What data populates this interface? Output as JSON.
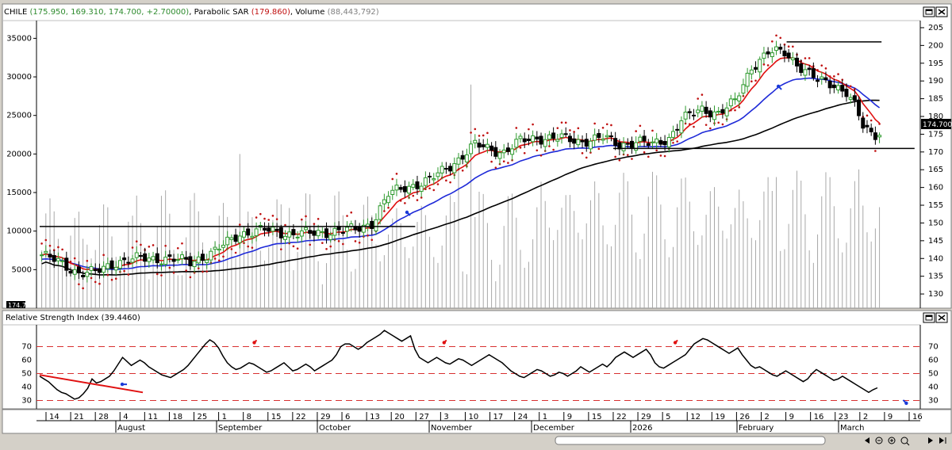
{
  "price_panel": {
    "symbol": "CHILE",
    "symbol_values": "(175.950, 169.310, 174.700, +2.70000)",
    "sar_label": "Parabolic SAR",
    "sar_value": "(179.860)",
    "volume_label": "Volume",
    "volume_value": "(88,443,792)",
    "last_price_tag": "174.7000",
    "left_stub": "174.7"
  },
  "rsi_panel": {
    "title": "Relative Strength Index (39.4460)"
  },
  "x_axis": {
    "days": [
      "14",
      "21",
      "28",
      "4",
      "11",
      "18",
      "25",
      "1",
      "8",
      "15",
      "22",
      "29",
      "6",
      "13",
      "20",
      "27",
      "3",
      "10",
      "17",
      "24",
      "1",
      "9",
      "15",
      "22",
      "29",
      "5",
      "12",
      "19",
      "26",
      "2",
      "9",
      "16",
      "23",
      "2",
      "9",
      "16"
    ],
    "months": [
      "August",
      "September",
      "October",
      "November",
      "December",
      "2026",
      "February",
      "March"
    ]
  },
  "chart_data": [
    {
      "type": "candlestick",
      "title": "CHILE",
      "price_axis": {
        "ticks": [
          130,
          135,
          140,
          145,
          150,
          155,
          160,
          165,
          170,
          175,
          180,
          185,
          190,
          195,
          200,
          205
        ],
        "ylim": [
          126,
          207
        ]
      },
      "volume_axis": {
        "ticks": [
          5000,
          10000,
          15000,
          20000,
          25000,
          30000,
          35000
        ]
      },
      "summary": {
        "open": 175.95,
        "low": 169.31,
        "close": 174.7,
        "change": 2.7,
        "parabolic_sar": 179.86,
        "volume": 88443792
      },
      "colors": {
        "up": "#2e9a2e",
        "down": "#000000",
        "ma_fast": "#e01010",
        "ma_mid": "#1e2ad8",
        "ma_slow": "#000000",
        "sar": "#c01010"
      },
      "close_anchors": [
        [
          0,
          141
        ],
        [
          4,
          139
        ],
        [
          9,
          136
        ],
        [
          13,
          136
        ],
        [
          18,
          139
        ],
        [
          24,
          140
        ],
        [
          30,
          140
        ],
        [
          36,
          139
        ],
        [
          42,
          142
        ],
        [
          48,
          147
        ],
        [
          54,
          148
        ],
        [
          60,
          147
        ],
        [
          66,
          147
        ],
        [
          72,
          148
        ],
        [
          76,
          148
        ],
        [
          80,
          150
        ],
        [
          84,
          158
        ],
        [
          88,
          160
        ],
        [
          94,
          162
        ],
        [
          100,
          167
        ],
        [
          105,
          172
        ],
        [
          108,
          171
        ],
        [
          112,
          170
        ],
        [
          116,
          173
        ],
        [
          120,
          174
        ],
        [
          125,
          174
        ],
        [
          130,
          173
        ],
        [
          136,
          174
        ],
        [
          140,
          172
        ],
        [
          144,
          173
        ],
        [
          148,
          172
        ],
        [
          152,
          174
        ],
        [
          155,
          179
        ],
        [
          160,
          182
        ],
        [
          164,
          181
        ],
        [
          168,
          184
        ],
        [
          172,
          194
        ],
        [
          176,
          198
        ],
        [
          180,
          198
        ],
        [
          184,
          194
        ],
        [
          188,
          190
        ],
        [
          192,
          189
        ],
        [
          195,
          187
        ],
        [
          197,
          183
        ],
        [
          199,
          177
        ],
        [
          201,
          175
        ],
        [
          203,
          174.7
        ]
      ],
      "trendlines": [
        {
          "from": [
            0,
            149
          ],
          "to": [
            91,
            149
          ]
        },
        {
          "from": [
            181,
            201
          ],
          "to": [
            204,
            201
          ]
        },
        {
          "from": [
            139,
            171
          ],
          "to": [
            212,
            171
          ]
        }
      ]
    },
    {
      "type": "line",
      "title": "Relative Strength Index (39.4460)",
      "y_ticks": [
        30,
        40,
        50,
        60,
        70
      ],
      "ylim": [
        25,
        85
      ],
      "reference_lines": [
        30,
        50,
        70
      ],
      "last_value": 39.446,
      "series": [
        {
          "values": [
            48,
            46,
            44,
            41,
            38,
            36,
            35,
            33,
            31,
            32,
            35,
            39,
            46,
            43,
            44,
            46,
            48,
            52,
            57,
            62,
            59,
            56,
            58,
            60,
            58,
            55,
            53,
            51,
            49,
            48,
            47,
            49,
            51,
            53,
            56,
            60,
            64,
            68,
            72,
            75,
            73,
            69,
            63,
            58,
            55,
            53,
            54,
            56,
            58,
            57,
            55,
            53,
            51,
            52,
            54,
            56,
            58,
            55,
            52,
            53,
            55,
            57,
            55,
            52,
            54,
            56,
            58,
            60,
            64,
            70,
            72,
            72,
            70,
            68,
            70,
            73,
            75,
            77,
            79,
            82,
            80,
            78,
            76,
            74,
            76,
            78,
            68,
            62,
            60,
            58,
            60,
            62,
            60,
            58,
            57,
            59,
            61,
            60,
            58,
            56,
            58,
            60,
            62,
            64,
            62,
            60,
            58,
            55,
            52,
            50,
            48,
            47,
            49,
            51,
            53,
            52,
            50,
            48,
            49,
            51,
            50,
            48,
            50,
            52,
            55,
            53,
            51,
            53,
            55,
            57,
            55,
            58,
            62,
            64,
            66,
            64,
            62,
            64,
            66,
            68,
            64,
            58,
            55,
            54,
            56,
            58,
            60,
            62,
            64,
            68,
            72,
            74,
            76,
            75,
            73,
            71,
            69,
            67,
            65,
            67,
            69,
            64,
            60,
            56,
            54,
            55,
            53,
            51,
            49,
            48,
            50,
            52,
            50,
            48,
            46,
            44,
            46,
            50,
            53,
            51,
            49,
            47,
            45,
            46,
            48,
            46,
            44,
            42,
            40,
            38,
            36,
            38,
            39.4
          ]
        }
      ],
      "trendlines": [
        {
          "from": [
            0,
            49
          ],
          "to": [
            25,
            36
          ]
        }
      ]
    }
  ]
}
